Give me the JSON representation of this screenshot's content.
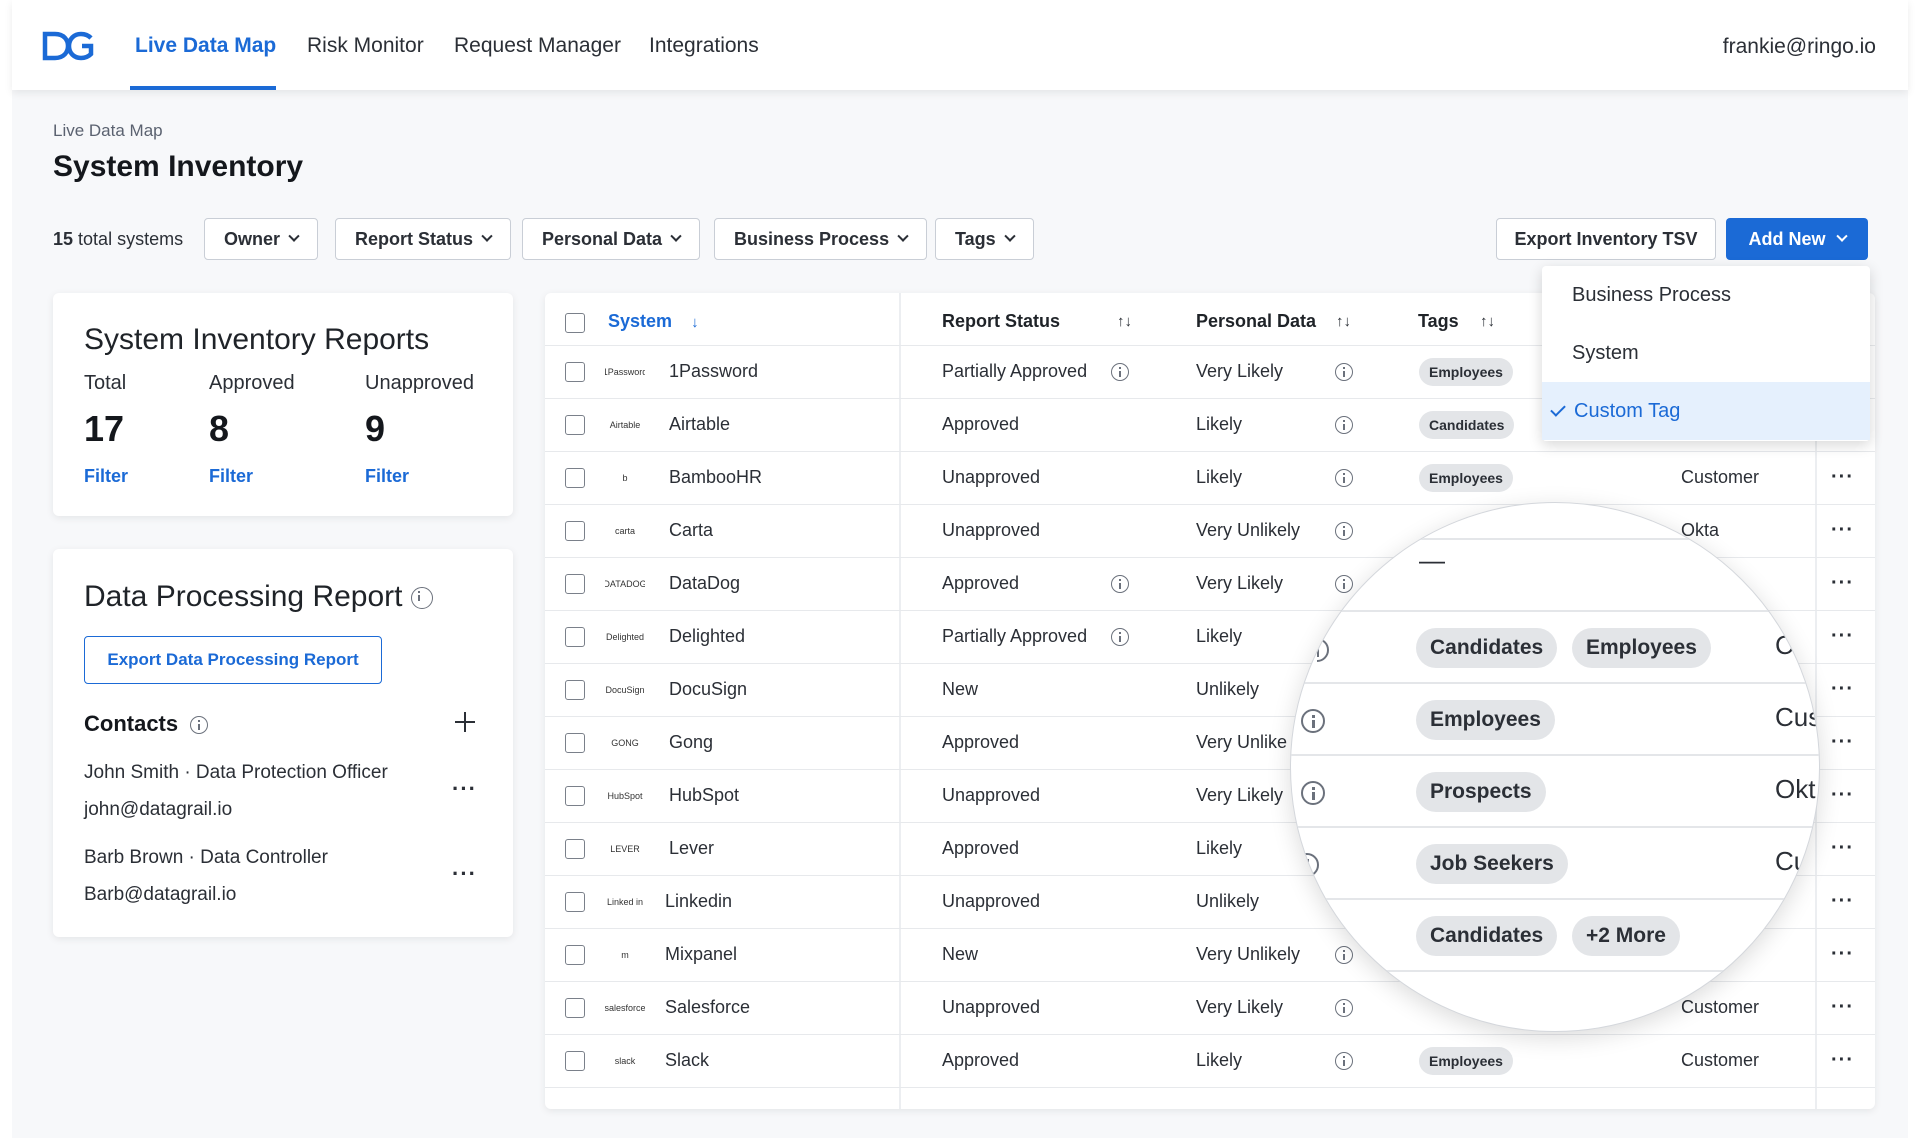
{
  "nav": {
    "items": [
      "Live Data Map",
      "Risk Monitor",
      "Request Manager",
      "Integrations"
    ],
    "user_email": "frankie@ringo.io"
  },
  "breadcrumb": "Live Data Map",
  "page_title": "System Inventory",
  "filters": {
    "total_count": "15",
    "total_label": "total systems",
    "buttons": [
      "Owner",
      "Report Status",
      "Personal Data",
      "Business Process",
      "Tags"
    ],
    "export_label": "Export Inventory TSV",
    "add_new_label": "Add New"
  },
  "add_new_menu": {
    "items": [
      "Business Process",
      "System",
      "Custom Tag"
    ],
    "selected": "Custom Tag"
  },
  "reports_card": {
    "title": "System Inventory Reports",
    "stats": [
      {
        "label": "Total",
        "value": "17",
        "filter": "Filter"
      },
      {
        "label": "Approved",
        "value": "8",
        "filter": "Filter"
      },
      {
        "label": "Unapproved",
        "value": "9",
        "filter": "Filter"
      }
    ]
  },
  "processing_card": {
    "title": "Data Processing Report",
    "export_label": "Export Data Processing Report",
    "contacts_title": "Contacts",
    "contacts": [
      {
        "line1": "John Smith · Data Protection Officer",
        "line2": "john@datagrail.io"
      },
      {
        "line1": "Barb Brown · Data Controller",
        "line2": "Barb@datagrail.io"
      }
    ]
  },
  "table": {
    "headers": {
      "system": "System",
      "report_status": "Report Status",
      "personal_data": "Personal Data",
      "tags": "Tags"
    },
    "sort_down": "↓",
    "sort_both": "↑↓",
    "rows": [
      {
        "logo": "1Password",
        "system": "1Password",
        "status": "Partially Approved",
        "status_info": true,
        "personal": "Very Likely",
        "personal_info": true,
        "tag": "Employees",
        "extra": ""
      },
      {
        "logo": "Airtable",
        "system": "Airtable",
        "status": "Approved",
        "status_info": false,
        "personal": "Likely",
        "personal_info": true,
        "tag": "Candidates",
        "extra": ""
      },
      {
        "logo": "b",
        "system": "BambooHR",
        "status": "Unapproved",
        "status_info": false,
        "personal": "Likely",
        "personal_info": true,
        "tag": "Employees",
        "extra": "Customer"
      },
      {
        "logo": "carta",
        "system": "Carta",
        "status": "Unapproved",
        "status_info": false,
        "personal": "Very Unlikely",
        "personal_info": true,
        "tag": "",
        "extra": "Okta"
      },
      {
        "logo": "DATADOG",
        "system": "DataDog",
        "status": "Approved",
        "status_info": true,
        "personal": "Very Likely",
        "personal_info": true,
        "tag": "",
        "extra": ""
      },
      {
        "logo": "Delighted",
        "system": "Delighted",
        "status": "Partially Approved",
        "status_info": true,
        "personal": "Likely",
        "personal_info": false,
        "tag": "",
        "extra": ""
      },
      {
        "logo": "DocuSign",
        "system": "DocuSign",
        "status": "New",
        "status_info": false,
        "personal": "Unlikely",
        "personal_info": false,
        "tag": "",
        "extra": ""
      },
      {
        "logo": "GONG",
        "system": "Gong",
        "status": "Approved",
        "status_info": false,
        "personal": "Very Unlike",
        "personal_info": false,
        "tag": "",
        "extra": ""
      },
      {
        "logo": "HubSpot",
        "system": "HubSpot",
        "status": "Unapproved",
        "status_info": false,
        "personal": "Very Likely",
        "personal_info": false,
        "tag": "",
        "extra": ""
      },
      {
        "logo": "LEVER",
        "system": "Lever",
        "status": "Approved",
        "status_info": false,
        "personal": "Likely",
        "personal_info": false,
        "tag": "",
        "extra": ""
      },
      {
        "logo": "Linked in",
        "system": "Linkedin",
        "status": "Unapproved",
        "status_info": false,
        "personal": "Unlikely",
        "personal_info": false,
        "tag": "",
        "extra": ""
      },
      {
        "logo": "m",
        "system": "Mixpanel",
        "status": "New",
        "status_info": false,
        "personal": "Very Unlikely",
        "personal_info": true,
        "tag": "",
        "extra": ""
      },
      {
        "logo": "salesforce",
        "system": "Salesforce",
        "status": "Unapproved",
        "status_info": false,
        "personal": "Very Likely",
        "personal_info": true,
        "tag": "",
        "extra": "Customer"
      },
      {
        "logo": "slack",
        "system": "Slack",
        "status": "Approved",
        "status_info": false,
        "personal": "Likely",
        "personal_info": true,
        "tag": "Employees",
        "extra": "Customer"
      }
    ]
  },
  "magnifier": {
    "dash": "—",
    "rows": [
      {
        "tags": [
          "Candidates",
          "Employees"
        ],
        "extra": "C"
      },
      {
        "tags": [
          "Employees"
        ],
        "extra": "Cus"
      },
      {
        "tags": [
          "Prospects"
        ],
        "extra": "Okt"
      },
      {
        "tags": [
          "Job Seekers"
        ],
        "extra": "Cu"
      },
      {
        "tags": [
          "Candidates",
          "+2 More"
        ],
        "extra": ""
      }
    ]
  },
  "colors": {
    "accent": "#1b6ad6",
    "tag_bg": "#e3e5e8",
    "selected_bg": "#e5f0fd"
  }
}
